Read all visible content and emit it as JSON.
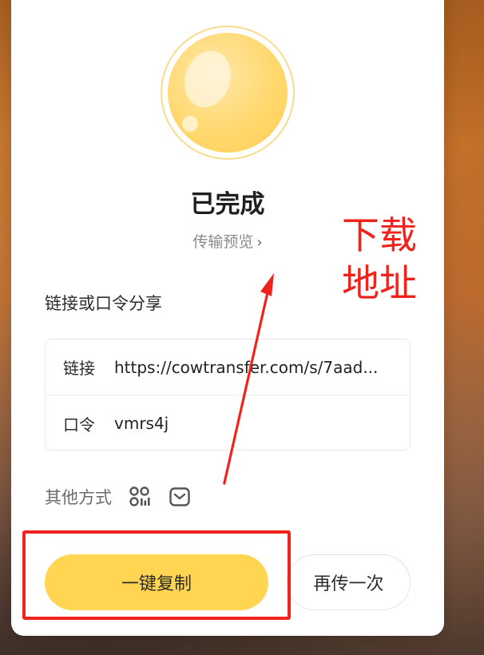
{
  "dialog": {
    "status_title": "已完成",
    "preview_link": "传输预览",
    "share_section_label": "链接或口令分享",
    "link_row": {
      "label": "链接",
      "value": "https://cowtransfer.com/s/7aad..."
    },
    "code_row": {
      "label": "口令",
      "value": "vmrs4j"
    },
    "other_methods_label": "其他方式",
    "other_methods_icons": [
      "qr-code-icon",
      "mail-icon"
    ],
    "primary_button": "一键复制",
    "secondary_button": "再传一次"
  },
  "annotation": {
    "text_line1": "下载",
    "text_line2": "地址",
    "color": "#f0231c"
  },
  "colors": {
    "accent": "#ffd552",
    "orb": "#ffd86e"
  }
}
